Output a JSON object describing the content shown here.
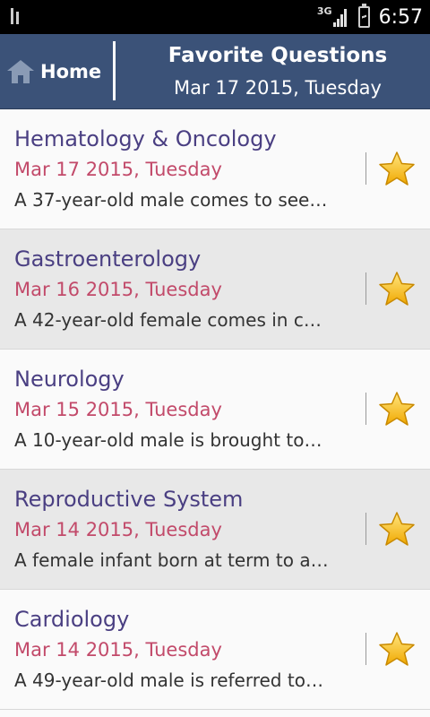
{
  "status_bar": {
    "network": "3G",
    "time": "6:57"
  },
  "header": {
    "home_label": "Home",
    "title": "Favorite Questions",
    "date": "Mar 17 2015, Tuesday"
  },
  "items": [
    {
      "title": "Hematology & Oncology",
      "date": "Mar 17 2015, Tuesday",
      "snippet": "A 37-year-old male comes to see…"
    },
    {
      "title": "Gastroenterology",
      "date": "Mar 16 2015, Tuesday",
      "snippet": "A 42-year-old female comes in c…"
    },
    {
      "title": "Neurology",
      "date": "Mar 15 2015, Tuesday",
      "snippet": "A 10-year-old male is brought to…"
    },
    {
      "title": "Reproductive System",
      "date": "Mar 14 2015, Tuesday",
      "snippet": "A female infant born at term to a…"
    },
    {
      "title": "Cardiology",
      "date": "Mar 14 2015, Tuesday",
      "snippet": "A 49-year-old male is referred to…"
    }
  ],
  "icons": {
    "favorite": "star-icon",
    "home": "home-icon"
  },
  "colors": {
    "header": "#3b5278",
    "title_text": "#4a3f82",
    "date_text": "#c24a6a",
    "star": "#f5b800"
  }
}
